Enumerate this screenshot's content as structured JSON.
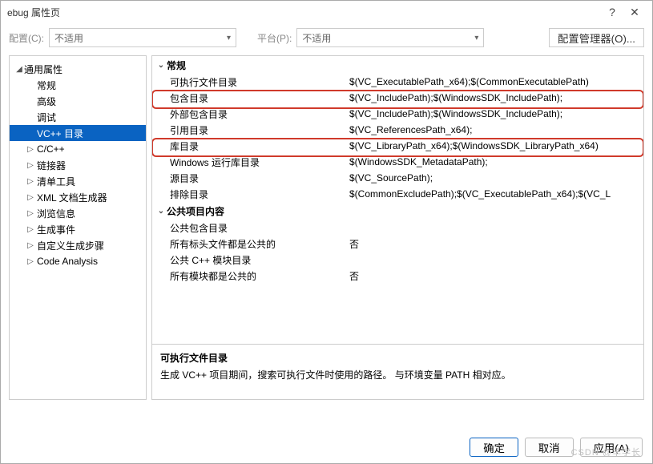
{
  "title": "ebug 属性页",
  "toolbar": {
    "cfg_label": "配置(C):",
    "cfg_value": "不适用",
    "plat_label": "平台(P):",
    "plat_value": "不适用",
    "cfgmgr": "配置管理器(O)..."
  },
  "tree": {
    "root": "通用属性",
    "items": [
      {
        "label": "常规",
        "exp": ""
      },
      {
        "label": "高级",
        "exp": ""
      },
      {
        "label": "调试",
        "exp": ""
      },
      {
        "label": "VC++ 目录",
        "exp": "",
        "sel": true
      },
      {
        "label": "C/C++",
        "exp": "▷"
      },
      {
        "label": "链接器",
        "exp": "▷"
      },
      {
        "label": "清单工具",
        "exp": "▷"
      },
      {
        "label": "XML 文档生成器",
        "exp": "▷"
      },
      {
        "label": "浏览信息",
        "exp": "▷"
      },
      {
        "label": "生成事件",
        "exp": "▷"
      },
      {
        "label": "自定义生成步骤",
        "exp": "▷"
      },
      {
        "label": "Code Analysis",
        "exp": "▷"
      }
    ]
  },
  "grid": {
    "cat1": "常规",
    "rows1": [
      {
        "k": "可执行文件目录",
        "v": "$(VC_ExecutablePath_x64);$(CommonExecutablePath)"
      },
      {
        "k": "包含目录",
        "v": "$(VC_IncludePath);$(WindowsSDK_IncludePath);"
      },
      {
        "k": "外部包含目录",
        "v": "$(VC_IncludePath);$(WindowsSDK_IncludePath);"
      },
      {
        "k": "引用目录",
        "v": "$(VC_ReferencesPath_x64);"
      },
      {
        "k": "库目录",
        "v": "$(VC_LibraryPath_x64);$(WindowsSDK_LibraryPath_x64)"
      },
      {
        "k": "Windows 运行库目录",
        "v": "$(WindowsSDK_MetadataPath);"
      },
      {
        "k": "源目录",
        "v": "$(VC_SourcePath);"
      },
      {
        "k": "排除目录",
        "v": "$(CommonExcludePath);$(VC_ExecutablePath_x64);$(VC_L"
      }
    ],
    "cat2": "公共项目内容",
    "rows2": [
      {
        "k": "公共包含目录",
        "v": ""
      },
      {
        "k": "所有标头文件都是公共的",
        "v": "否"
      },
      {
        "k": "公共 C++ 模块目录",
        "v": ""
      },
      {
        "k": "所有模块都是公共的",
        "v": "否"
      }
    ]
  },
  "desc": {
    "head": "可执行文件目录",
    "body": "生成 VC++ 项目期间，搜索可执行文件时使用的路径。 与环境变量 PATH 相对应。"
  },
  "footer": {
    "ok": "确定",
    "cancel": "取消",
    "apply": "应用(A)"
  },
  "watermark": "CSDN @羊学长"
}
